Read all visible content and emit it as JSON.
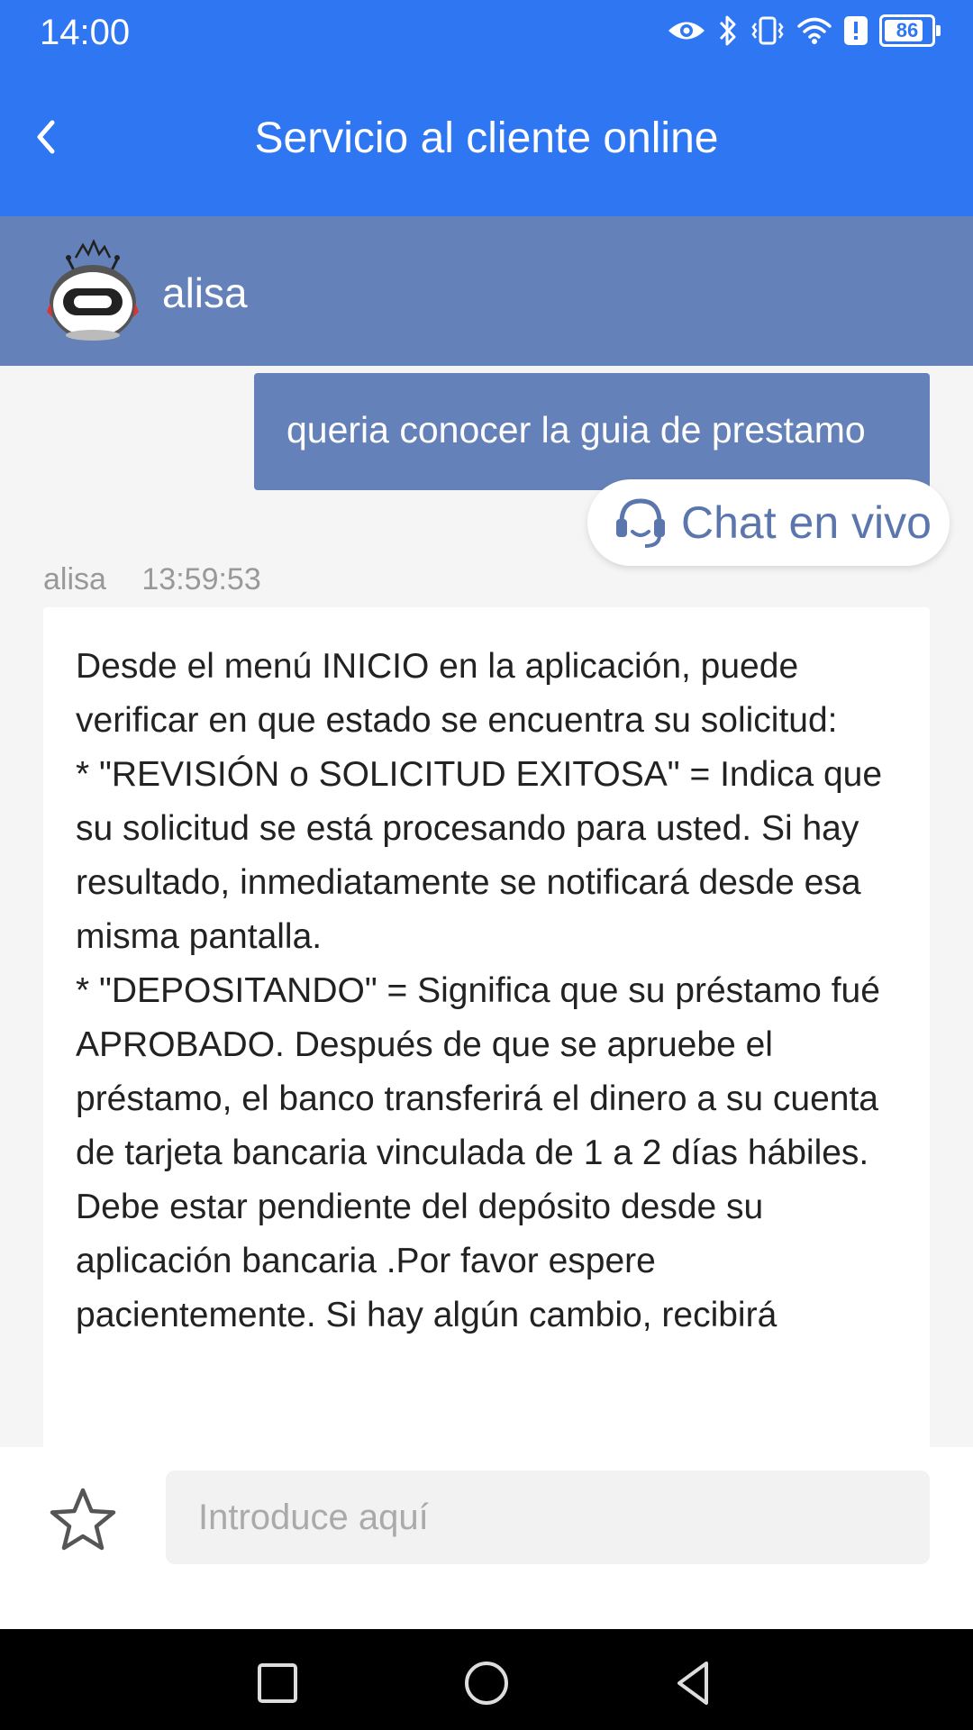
{
  "status_bar": {
    "time": "14:00",
    "battery_percent": 86,
    "battery_label": "86",
    "icons": [
      "eye-icon",
      "bluetooth-icon",
      "vibrate-icon",
      "wifi-icon",
      "alert-icon",
      "battery-icon"
    ]
  },
  "app_bar": {
    "title": "Servicio al cliente online",
    "back_icon": "chevron-left-icon"
  },
  "agent": {
    "name": "alisa",
    "avatar_icon": "robot-avatar-icon"
  },
  "messages": {
    "user_message": "queria conocer la guia de prestamo",
    "live_chat_label": "Chat en vivo",
    "agent_meta": {
      "sender": "alisa",
      "time": "13:59:53"
    },
    "agent_message": "Desde el menú INICIO en la aplicación, puede verificar en que estado se encuentra su solicitud:\n* \"REVISIÓN o SOLICITUD EXITOSA\" = Indica que su solicitud se está procesando para usted. Si hay resultado, inmediatamente se notificará desde esa misma pantalla.\n* \"DEPOSITANDO\" = Significa que su préstamo fué APROBADO. Después de que se apruebe el préstamo, el banco transferirá el dinero a su cuenta de tarjeta bancaria vinculada de 1 a 2 días hábiles. Debe estar pendiente del depósito desde su aplicación bancaria .Por favor espere pacientemente. Si hay algún cambio, recibirá"
  },
  "input": {
    "placeholder": "Introduce aquí",
    "value": ""
  },
  "colors": {
    "primary": "#2f76f3",
    "agent_bar": "#6482b9",
    "user_bubble": "#6482b9",
    "background": "#f5f5f5"
  }
}
